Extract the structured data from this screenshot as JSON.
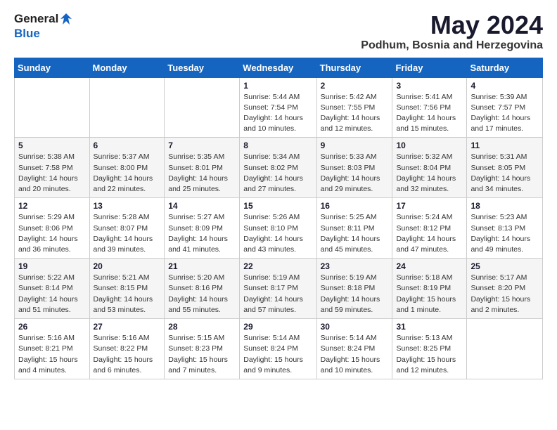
{
  "header": {
    "logo_general": "General",
    "logo_blue": "Blue",
    "month": "May 2024",
    "location": "Podhum, Bosnia and Herzegovina"
  },
  "weekdays": [
    "Sunday",
    "Monday",
    "Tuesday",
    "Wednesday",
    "Thursday",
    "Friday",
    "Saturday"
  ],
  "weeks": [
    [
      {
        "day": "",
        "info": ""
      },
      {
        "day": "",
        "info": ""
      },
      {
        "day": "",
        "info": ""
      },
      {
        "day": "1",
        "info": "Sunrise: 5:44 AM\nSunset: 7:54 PM\nDaylight: 14 hours\nand 10 minutes."
      },
      {
        "day": "2",
        "info": "Sunrise: 5:42 AM\nSunset: 7:55 PM\nDaylight: 14 hours\nand 12 minutes."
      },
      {
        "day": "3",
        "info": "Sunrise: 5:41 AM\nSunset: 7:56 PM\nDaylight: 14 hours\nand 15 minutes."
      },
      {
        "day": "4",
        "info": "Sunrise: 5:39 AM\nSunset: 7:57 PM\nDaylight: 14 hours\nand 17 minutes."
      }
    ],
    [
      {
        "day": "5",
        "info": "Sunrise: 5:38 AM\nSunset: 7:58 PM\nDaylight: 14 hours\nand 20 minutes."
      },
      {
        "day": "6",
        "info": "Sunrise: 5:37 AM\nSunset: 8:00 PM\nDaylight: 14 hours\nand 22 minutes."
      },
      {
        "day": "7",
        "info": "Sunrise: 5:35 AM\nSunset: 8:01 PM\nDaylight: 14 hours\nand 25 minutes."
      },
      {
        "day": "8",
        "info": "Sunrise: 5:34 AM\nSunset: 8:02 PM\nDaylight: 14 hours\nand 27 minutes."
      },
      {
        "day": "9",
        "info": "Sunrise: 5:33 AM\nSunset: 8:03 PM\nDaylight: 14 hours\nand 29 minutes."
      },
      {
        "day": "10",
        "info": "Sunrise: 5:32 AM\nSunset: 8:04 PM\nDaylight: 14 hours\nand 32 minutes."
      },
      {
        "day": "11",
        "info": "Sunrise: 5:31 AM\nSunset: 8:05 PM\nDaylight: 14 hours\nand 34 minutes."
      }
    ],
    [
      {
        "day": "12",
        "info": "Sunrise: 5:29 AM\nSunset: 8:06 PM\nDaylight: 14 hours\nand 36 minutes."
      },
      {
        "day": "13",
        "info": "Sunrise: 5:28 AM\nSunset: 8:07 PM\nDaylight: 14 hours\nand 39 minutes."
      },
      {
        "day": "14",
        "info": "Sunrise: 5:27 AM\nSunset: 8:09 PM\nDaylight: 14 hours\nand 41 minutes."
      },
      {
        "day": "15",
        "info": "Sunrise: 5:26 AM\nSunset: 8:10 PM\nDaylight: 14 hours\nand 43 minutes."
      },
      {
        "day": "16",
        "info": "Sunrise: 5:25 AM\nSunset: 8:11 PM\nDaylight: 14 hours\nand 45 minutes."
      },
      {
        "day": "17",
        "info": "Sunrise: 5:24 AM\nSunset: 8:12 PM\nDaylight: 14 hours\nand 47 minutes."
      },
      {
        "day": "18",
        "info": "Sunrise: 5:23 AM\nSunset: 8:13 PM\nDaylight: 14 hours\nand 49 minutes."
      }
    ],
    [
      {
        "day": "19",
        "info": "Sunrise: 5:22 AM\nSunset: 8:14 PM\nDaylight: 14 hours\nand 51 minutes."
      },
      {
        "day": "20",
        "info": "Sunrise: 5:21 AM\nSunset: 8:15 PM\nDaylight: 14 hours\nand 53 minutes."
      },
      {
        "day": "21",
        "info": "Sunrise: 5:20 AM\nSunset: 8:16 PM\nDaylight: 14 hours\nand 55 minutes."
      },
      {
        "day": "22",
        "info": "Sunrise: 5:19 AM\nSunset: 8:17 PM\nDaylight: 14 hours\nand 57 minutes."
      },
      {
        "day": "23",
        "info": "Sunrise: 5:19 AM\nSunset: 8:18 PM\nDaylight: 14 hours\nand 59 minutes."
      },
      {
        "day": "24",
        "info": "Sunrise: 5:18 AM\nSunset: 8:19 PM\nDaylight: 15 hours\nand 1 minute."
      },
      {
        "day": "25",
        "info": "Sunrise: 5:17 AM\nSunset: 8:20 PM\nDaylight: 15 hours\nand 2 minutes."
      }
    ],
    [
      {
        "day": "26",
        "info": "Sunrise: 5:16 AM\nSunset: 8:21 PM\nDaylight: 15 hours\nand 4 minutes."
      },
      {
        "day": "27",
        "info": "Sunrise: 5:16 AM\nSunset: 8:22 PM\nDaylight: 15 hours\nand 6 minutes."
      },
      {
        "day": "28",
        "info": "Sunrise: 5:15 AM\nSunset: 8:23 PM\nDaylight: 15 hours\nand 7 minutes."
      },
      {
        "day": "29",
        "info": "Sunrise: 5:14 AM\nSunset: 8:24 PM\nDaylight: 15 hours\nand 9 minutes."
      },
      {
        "day": "30",
        "info": "Sunrise: 5:14 AM\nSunset: 8:24 PM\nDaylight: 15 hours\nand 10 minutes."
      },
      {
        "day": "31",
        "info": "Sunrise: 5:13 AM\nSunset: 8:25 PM\nDaylight: 15 hours\nand 12 minutes."
      },
      {
        "day": "",
        "info": ""
      }
    ]
  ]
}
